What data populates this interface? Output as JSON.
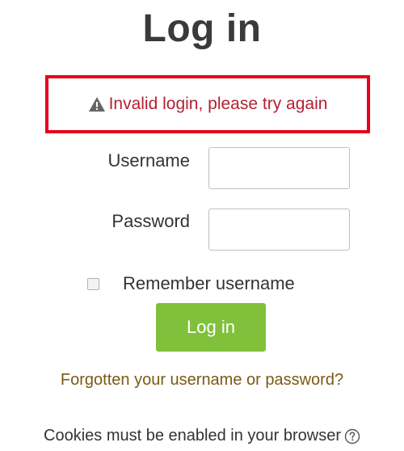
{
  "page_title": "Log in",
  "error": {
    "message": "Invalid login, please try again",
    "icon": "warning-icon",
    "border_color": "#e8001c",
    "text_color": "#b52030"
  },
  "form": {
    "username_label": "Username",
    "username_value": "",
    "password_label": "Password",
    "password_value": "",
    "remember_label": "Remember username",
    "remember_checked": false,
    "submit_label": "Log in",
    "submit_color": "#80c03a"
  },
  "links": {
    "forgot": "Forgotten your username or password?",
    "forgot_color": "#7a5a12"
  },
  "footer": {
    "cookies_text": "Cookies must be enabled in your browser",
    "help_icon": "help-circle-icon"
  }
}
